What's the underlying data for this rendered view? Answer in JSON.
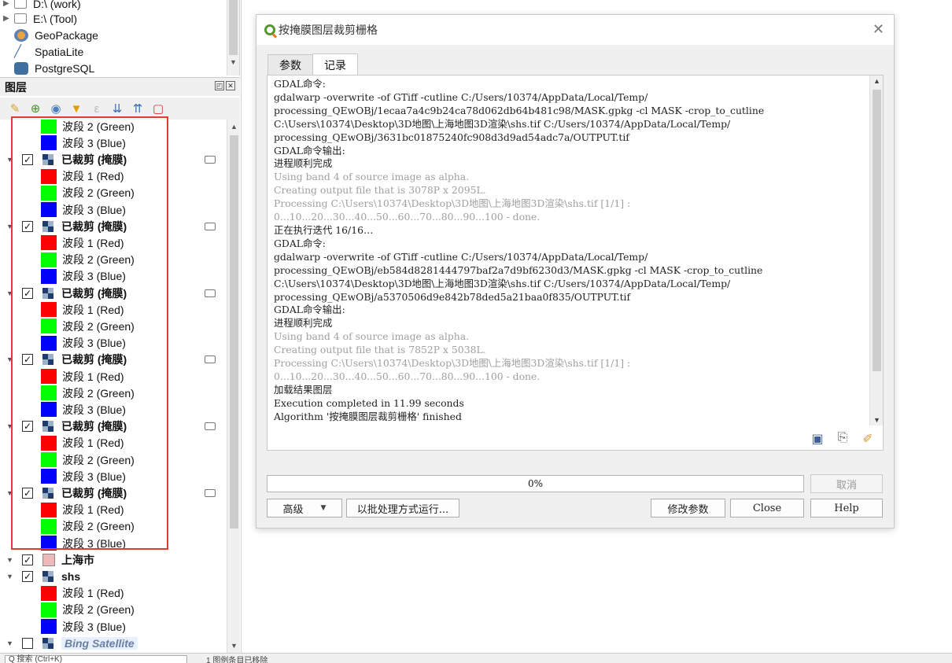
{
  "browser": {
    "items": [
      {
        "label": "D:\\ (work)"
      },
      {
        "label": "E:\\ (Tool)"
      },
      {
        "label": "GeoPackage"
      },
      {
        "label": "SpatiaLite"
      },
      {
        "label": "PostgreSQL"
      }
    ]
  },
  "layers_panel": {
    "title": "图层",
    "layers": [
      {
        "type": "band",
        "color": "#00ff00",
        "label": "波段 2 (Green)"
      },
      {
        "type": "band",
        "color": "#0000ff",
        "label": "波段 3 (Blue)"
      },
      {
        "type": "raster",
        "label": "已裁剪 (掩膜)",
        "checked": "✓"
      },
      {
        "type": "band",
        "color": "#ff0000",
        "label": "波段 1 (Red)"
      },
      {
        "type": "band",
        "color": "#00ff00",
        "label": "波段 2 (Green)"
      },
      {
        "type": "band",
        "color": "#0000ff",
        "label": "波段 3 (Blue)"
      },
      {
        "type": "raster",
        "label": "已裁剪 (掩膜)",
        "checked": "✓"
      },
      {
        "type": "band",
        "color": "#ff0000",
        "label": "波段 1 (Red)"
      },
      {
        "type": "band",
        "color": "#00ff00",
        "label": "波段 2 (Green)"
      },
      {
        "type": "band",
        "color": "#0000ff",
        "label": "波段 3 (Blue)"
      },
      {
        "type": "raster",
        "label": "已裁剪 (掩膜)",
        "checked": "✓"
      },
      {
        "type": "band",
        "color": "#ff0000",
        "label": "波段 1 (Red)"
      },
      {
        "type": "band",
        "color": "#00ff00",
        "label": "波段 2 (Green)"
      },
      {
        "type": "band",
        "color": "#0000ff",
        "label": "波段 3 (Blue)"
      },
      {
        "type": "raster",
        "label": "已裁剪 (掩膜)",
        "checked": "✓"
      },
      {
        "type": "band",
        "color": "#ff0000",
        "label": "波段 1 (Red)"
      },
      {
        "type": "band",
        "color": "#00ff00",
        "label": "波段 2 (Green)"
      },
      {
        "type": "band",
        "color": "#0000ff",
        "label": "波段 3 (Blue)"
      },
      {
        "type": "raster",
        "label": "已裁剪 (掩膜)",
        "checked": "✓"
      },
      {
        "type": "band",
        "color": "#ff0000",
        "label": "波段 1 (Red)"
      },
      {
        "type": "band",
        "color": "#00ff00",
        "label": "波段 2 (Green)"
      },
      {
        "type": "band",
        "color": "#0000ff",
        "label": "波段 3 (Blue)"
      },
      {
        "type": "raster",
        "label": "已裁剪 (掩膜)",
        "checked": "✓"
      },
      {
        "type": "band",
        "color": "#ff0000",
        "label": "波段 1 (Red)"
      },
      {
        "type": "band",
        "color": "#00ff00",
        "label": "波段 2 (Green)"
      },
      {
        "type": "band",
        "color": "#0000ff",
        "label": "波段 3 (Blue)"
      },
      {
        "type": "polygon",
        "label": "上海市",
        "checked": "✓"
      },
      {
        "type": "raster",
        "label": "shs",
        "checked": "✓"
      },
      {
        "type": "band",
        "color": "#ff0000",
        "label": "波段 1 (Red)"
      },
      {
        "type": "band",
        "color": "#00ff00",
        "label": "波段 2 (Green)"
      },
      {
        "type": "band",
        "color": "#0000ff",
        "label": "波段 3 (Blue)"
      },
      {
        "type": "raster",
        "label": "Bing Satellite",
        "checked": "",
        "italic": true
      }
    ]
  },
  "statusbar": {
    "locator_placeholder": "Q 搜索 (Ctrl+K)",
    "message": "1 图例条目已移除"
  },
  "dialog": {
    "title": "按掩膜图层裁剪栅格",
    "tabs": [
      "参数",
      "记录"
    ],
    "log": [
      {
        "text": "GDAL命令:",
        "gray": false
      },
      {
        "text": "gdalwarp -overwrite -of GTiff -cutline C:/Users/10374/AppData/Local/Temp/",
        "gray": false
      },
      {
        "text": "processing_QEwOBj/1ecaa7a4c9b24ca78d062db64b481c98/MASK.gpkg -cl MASK -crop_to_cutline",
        "gray": false
      },
      {
        "text": "C:\\Users\\10374\\Desktop\\3D地图\\上海地图3D渲染\\shs.tif C:/Users/10374/AppData/Local/Temp/",
        "gray": false
      },
      {
        "text": "processing_QEwOBj/3631bc01875240fc908d3d9ad54adc7a/OUTPUT.tif",
        "gray": false
      },
      {
        "text": "GDAL命令输出:",
        "gray": false
      },
      {
        "text": "进程顺利完成",
        "gray": false
      },
      {
        "text": "Using band 4 of source image as alpha.",
        "gray": true
      },
      {
        "text": "Creating output file that is 3078P x 2095L.",
        "gray": true
      },
      {
        "text": "Processing C:\\Users\\10374\\Desktop\\3D地图\\上海地图3D渲染\\shs.tif [1/1] :",
        "gray": true
      },
      {
        "text": "0...10...20...30...40...50...60...70...80...90...100 - done.",
        "gray": true
      },
      {
        "text": "正在执行迭代 16/16…",
        "gray": false
      },
      {
        "text": "GDAL命令:",
        "gray": false
      },
      {
        "text": "gdalwarp -overwrite -of GTiff -cutline C:/Users/10374/AppData/Local/Temp/",
        "gray": false
      },
      {
        "text": "processing_QEwOBj/eb584d8281444797baf2a7d9bf6230d3/MASK.gpkg -cl MASK -crop_to_cutline",
        "gray": false
      },
      {
        "text": "C:\\Users\\10374\\Desktop\\3D地图\\上海地图3D渲染\\shs.tif C:/Users/10374/AppData/Local/Temp/",
        "gray": false
      },
      {
        "text": "processing_QEwOBj/a5370506d9e842b78ded5a21baa0f835/OUTPUT.tif",
        "gray": false
      },
      {
        "text": "GDAL命令输出:",
        "gray": false
      },
      {
        "text": "进程顺利完成",
        "gray": false
      },
      {
        "text": "Using band 4 of source image as alpha.",
        "gray": true
      },
      {
        "text": "Creating output file that is 7852P x 5038L.",
        "gray": true
      },
      {
        "text": "Processing C:\\Users\\10374\\Desktop\\3D地图\\上海地图3D渲染\\shs.tif [1/1] :",
        "gray": true
      },
      {
        "text": "0...10...20...30...40...50...60...70...80...90...100 - done.",
        "gray": true
      },
      {
        "text": "加载结果图层",
        "gray": false
      },
      {
        "text": "Execution completed in 11.99 seconds",
        "gray": false
      },
      {
        "text": "Algorithm '按掩膜图层裁剪栅格' finished",
        "gray": false
      }
    ],
    "progress_text": "0%",
    "buttons": {
      "cancel": "取消",
      "advanced": "高级",
      "batch": "以批处理方式运行...",
      "modify": "修改参数",
      "close": "Close",
      "help": "Help"
    }
  }
}
